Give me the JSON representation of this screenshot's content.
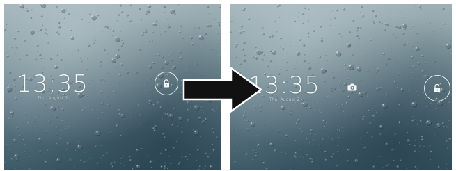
{
  "left_screen": {
    "clock": {
      "time": "13:35",
      "date": "Thu, August 2"
    },
    "lock_icon": "locked-padlock-icon"
  },
  "right_screen": {
    "clock": {
      "time": "13:35",
      "date": "Thu, August 2"
    },
    "camera_icon": "camera-icon",
    "unlock_icon": "unlocked-padlock-icon"
  },
  "transition_arrow": "right-arrow-icon",
  "colors": {
    "wallpaper_top": "#9fb1b7",
    "wallpaper_bottom": "#3e5a68",
    "clock_text": "#f4f7f8",
    "arrow_fill": "#111111",
    "arrow_stroke": "#ffffff"
  }
}
